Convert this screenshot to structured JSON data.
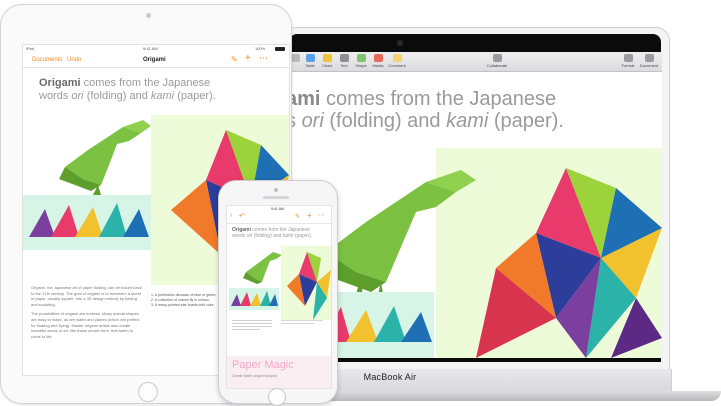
{
  "mac": {
    "label": "MacBook Air",
    "toolbar": {
      "items": [
        "Table",
        "Chart",
        "Text",
        "Shape",
        "Media",
        "Comment"
      ],
      "collaborate": "Collaborate",
      "format": "Format",
      "document": "Document"
    },
    "heading_line1_bold": "ami",
    "heading_line1_rest": " comes from the Japanese",
    "heading_line2_a": "s ",
    "heading_line2_ori": "ori",
    "heading_line2_mid": " (folding) and ",
    "heading_line2_kami": "kami",
    "heading_line2_end": " (paper)."
  },
  "ipad": {
    "status_left": "iPad",
    "status_time": "9:41 AM",
    "status_right": "100%",
    "nav_documents": "Documents",
    "nav_undo": "Undo",
    "nav_title": "Origami",
    "heading_bold": "Origami",
    "heading_rest": " comes from the Japanese",
    "heading_line2_a": "words ",
    "heading_line2_ori": "ori",
    "heading_line2_mid": " (folding) and ",
    "heading_line2_kami": "kami",
    "heading_line2_end": " (paper).",
    "body_p1": "Origami, the Japanese art of paper folding, can be traced back to the 17th century. The goal of origami is to transform a sheet of paper, usually square, into a 3D design entirely by folding and sculpting.",
    "body_p2": "The possibilities of origami are endless. Many animal shapes are easy to make, as are water and planes (which are perfect for floating and flying). Master origami artists also create beautiful works of art, like those shown here, that seem to come to life.",
    "list": [
      "1. A prehistoric dinosaur of blue or green.",
      "2. A collection of cranes fly in unison.",
      "3. A many-pointed star bursts with color."
    ]
  },
  "iphone": {
    "status_time": "9:41 AM",
    "heading_bold": "Origami",
    "heading_rest": " comes from the Japanese",
    "heading_line2": "words ori (folding) and kami (paper).",
    "paper_magic": "Paper Magic",
    "paper_magic_sub": "Create Matte origami shapes"
  },
  "colors": {
    "accent": "#f28a1c",
    "dino": "#7cc142",
    "mint": "#d6f5e6",
    "lightgreen": "#eefbd9"
  }
}
